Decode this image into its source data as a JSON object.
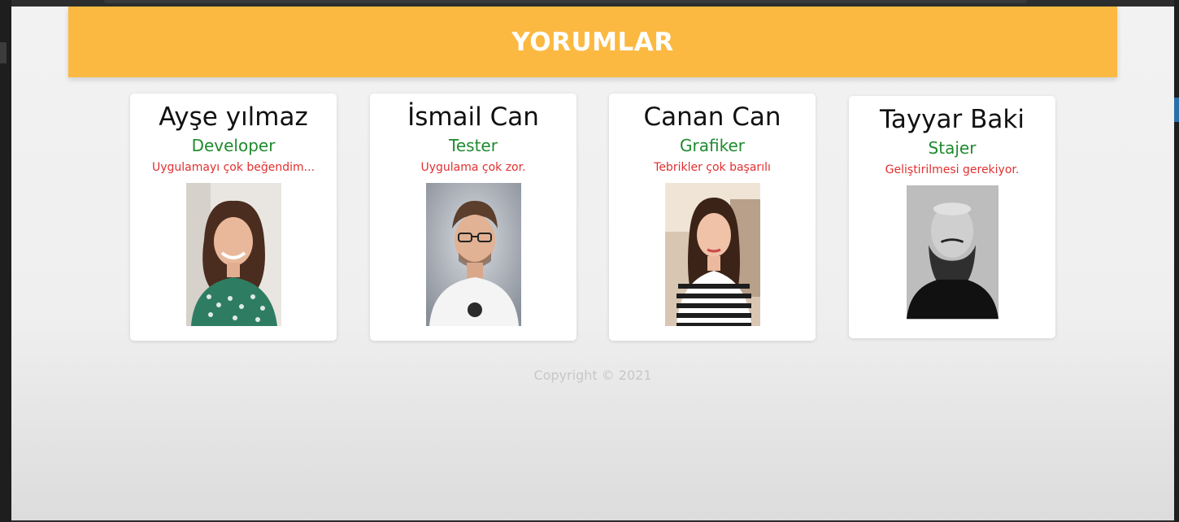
{
  "header": {
    "title": "YORUMLAR"
  },
  "cards": [
    {
      "name": "Ayşe yılmaz",
      "role": "Developer",
      "comment": "Uygulamayı çok beğendim..."
    },
    {
      "name": "İsmail Can",
      "role": "Tester",
      "comment": "Uygulama çok zor."
    },
    {
      "name": "Canan Can",
      "role": "Grafiker",
      "comment": "Tebrikler çok başarılı"
    },
    {
      "name": "Tayyar Baki",
      "role": "Stajer",
      "comment": "Geliştirilmesi gerekiyor."
    }
  ],
  "footer": {
    "copyright": "Copyright © 2021"
  },
  "colors": {
    "header_bg": "#fcb941",
    "role_text": "#1f8a2e",
    "comment_text": "#e03030"
  }
}
